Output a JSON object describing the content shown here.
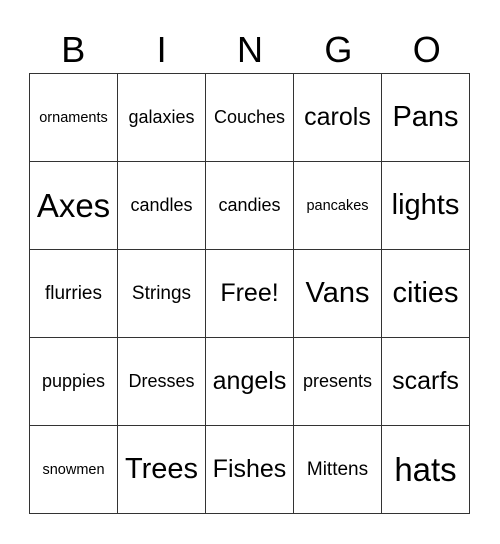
{
  "header": {
    "letters": [
      "B",
      "I",
      "N",
      "G",
      "O"
    ]
  },
  "grid": {
    "rows": [
      [
        "ornaments",
        "galaxies",
        "Couches",
        "carols",
        "Pans"
      ],
      [
        "Axes",
        "candles",
        "candies",
        "pancakes",
        "lights"
      ],
      [
        "flurries",
        "Strings",
        "Free!",
        "Vans",
        "cities"
      ],
      [
        "puppies",
        "Dresses",
        "angels",
        "presents",
        "scarfs"
      ],
      [
        "snowmen",
        "Trees",
        "Fishes",
        "Mittens",
        "hats"
      ]
    ]
  }
}
